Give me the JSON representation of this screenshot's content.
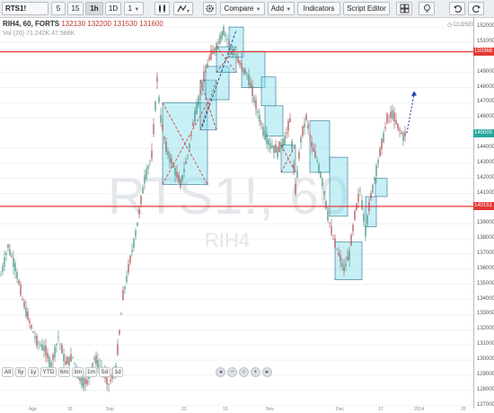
{
  "toolbar": {
    "symbol": "RTS1!",
    "intervals": [
      "5",
      "15",
      "1h",
      "1D",
      "1"
    ],
    "active_interval": "1h",
    "compare_label": "Compare",
    "add_label": "Add",
    "indicators_label": "Indicators",
    "script_editor_label": "Script Editor"
  },
  "legend": {
    "symbol_line": "RIH4, 60, FORTS",
    "open": "132130",
    "high": "132200",
    "low": "131530",
    "close": "131600",
    "volume_line": "Vol (20)  71.242K  47.586K"
  },
  "watermark": {
    "ticker": "RTS1!, 60",
    "symbol": "RIH4"
  },
  "status": {
    "market": "CLOSED"
  },
  "price_axis": {
    "labels": [
      "152000",
      "151000",
      "149000",
      "148000",
      "147000",
      "146000",
      "144000",
      "143000",
      "142000",
      "141000",
      "139000",
      "138000",
      "137000",
      "136000",
      "135000",
      "134000",
      "133000",
      "132000",
      "131000",
      "130000",
      "129000",
      "128000",
      "127000"
    ],
    "badges": [
      {
        "text": "150368",
        "color": "#e53935",
        "value": 150368
      },
      {
        "text": "145000",
        "color": "#26a69a",
        "value": 145000
      },
      {
        "text": "140151",
        "color": "#e53935",
        "value": 140151
      }
    ]
  },
  "range_buttons": [
    "All",
    "5y",
    "1y",
    "YTD",
    "6m",
    "3m",
    "1m",
    "5d",
    "1d"
  ],
  "nav_buttons": [
    "chevron-left",
    "zoom-out",
    "reset",
    "zoom-in",
    "chevron-right"
  ],
  "time_axis": [
    "Ago",
    "15",
    "Sep",
    "23",
    "15",
    "Nov",
    "Dec",
    "17",
    "2014",
    "20"
  ],
  "colors": {
    "accent": "#e53935",
    "up": "#26a69a",
    "box": "#80deea",
    "line": "#e53935"
  },
  "chart_data": {
    "type": "line",
    "title": "RIH4, 60, FORTS",
    "ylim": [
      126800,
      152600
    ],
    "x": [
      0,
      8,
      16,
      24,
      32,
      40,
      48,
      56,
      64,
      72,
      80,
      88,
      96,
      104,
      112,
      120,
      128,
      136,
      144,
      152,
      160,
      168,
      174,
      178,
      184,
      192,
      200,
      208,
      216,
      224,
      232,
      240,
      248,
      256,
      262,
      268,
      276,
      284,
      292,
      300,
      308,
      316,
      322,
      328,
      334,
      340,
      346,
      352,
      358,
      364,
      370,
      376,
      382,
      388,
      394,
      400,
      406,
      412,
      418,
      424,
      430,
      436,
      442,
      448,
      452
    ],
    "values": [
      135600,
      137500,
      136200,
      134000,
      132500,
      131200,
      130800,
      129700,
      131500,
      129800,
      130200,
      128700,
      128500,
      130100,
      129500,
      128400,
      129400,
      134200,
      136600,
      139000,
      142000,
      143500,
      148500,
      146000,
      144000,
      142800,
      141600,
      143500,
      146200,
      148200,
      149900,
      150700,
      151800,
      150600,
      150000,
      149400,
      148600,
      146800,
      145200,
      144200,
      143800,
      144600,
      145800,
      141200,
      144600,
      146000,
      144200,
      143200,
      141800,
      139600,
      138000,
      137000,
      136000,
      137000,
      139500,
      141200,
      138600,
      140800,
      142600,
      144200,
      145900,
      146300,
      145400,
      144800,
      145000
    ],
    "projection": [
      [
        452,
        145000
      ],
      [
        460,
        147600
      ]
    ],
    "levels": [
      150368,
      140151
    ]
  }
}
